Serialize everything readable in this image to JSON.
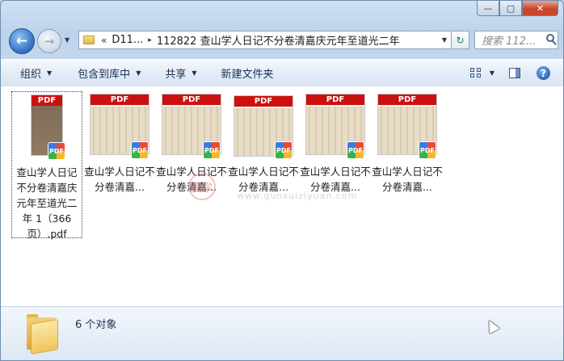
{
  "window": {
    "caption": {
      "minimize_label": "—",
      "maximize_label": "▢",
      "close_label": "✕"
    }
  },
  "nav": {
    "back_glyph": "←",
    "forward_glyph": "→",
    "dropdown_glyph": "▼"
  },
  "address": {
    "overflow": "«",
    "segments": [
      "D11...",
      "112822 查山学人日记不分卷清嘉庆元年至道光二年"
    ],
    "separator": "▸",
    "dropdown_glyph": "▼",
    "refresh_glyph": "↻"
  },
  "search": {
    "placeholder": "搜索 112..."
  },
  "toolbar": {
    "organize": "组织",
    "include_in_library": "包含到库中",
    "share": "共享",
    "new_folder": "新建文件夹",
    "dropdown_glyph": "▼",
    "help_glyph": "?"
  },
  "files": [
    {
      "name": "查山学人日记不分卷清嘉庆元年至道光二年 1（366页）.pdf",
      "selected": true,
      "thumb": "dark"
    },
    {
      "name": "查山学人日记不分卷清嘉...",
      "selected": false,
      "thumb": "page"
    },
    {
      "name": "查山学人日记不分卷清嘉...",
      "selected": false,
      "thumb": "page"
    },
    {
      "name": "查山学人日记不分卷清嘉...",
      "selected": false,
      "thumb": "page"
    },
    {
      "name": "查山学人日记不分卷清嘉...",
      "selected": false,
      "thumb": "page"
    },
    {
      "name": "查山学人日记不分卷清嘉...",
      "selected": false,
      "thumb": "page"
    }
  ],
  "thumb_badge": {
    "banner_text": "PDF",
    "badge_text": "PDF"
  },
  "watermark": {
    "text": "国学",
    "url": "www.guoxuiziyuan.com"
  },
  "details": {
    "object_count": "6 个对象"
  },
  "icons": {
    "back": "arrow-left-icon",
    "forward": "arrow-right-icon",
    "folder": "folder-icon",
    "search": "search-icon",
    "refresh": "refresh-icon",
    "views": "views-icon",
    "preview_pane": "preview-pane-icon",
    "help": "help-icon",
    "pdf": "pdf-icon",
    "cursor": "mouse-cursor-icon"
  },
  "colors": {
    "accent": "#2d6fc2",
    "pdf_red": "#cc1010",
    "close_red": "#c8462c",
    "details_bg": "#dde8f4"
  }
}
